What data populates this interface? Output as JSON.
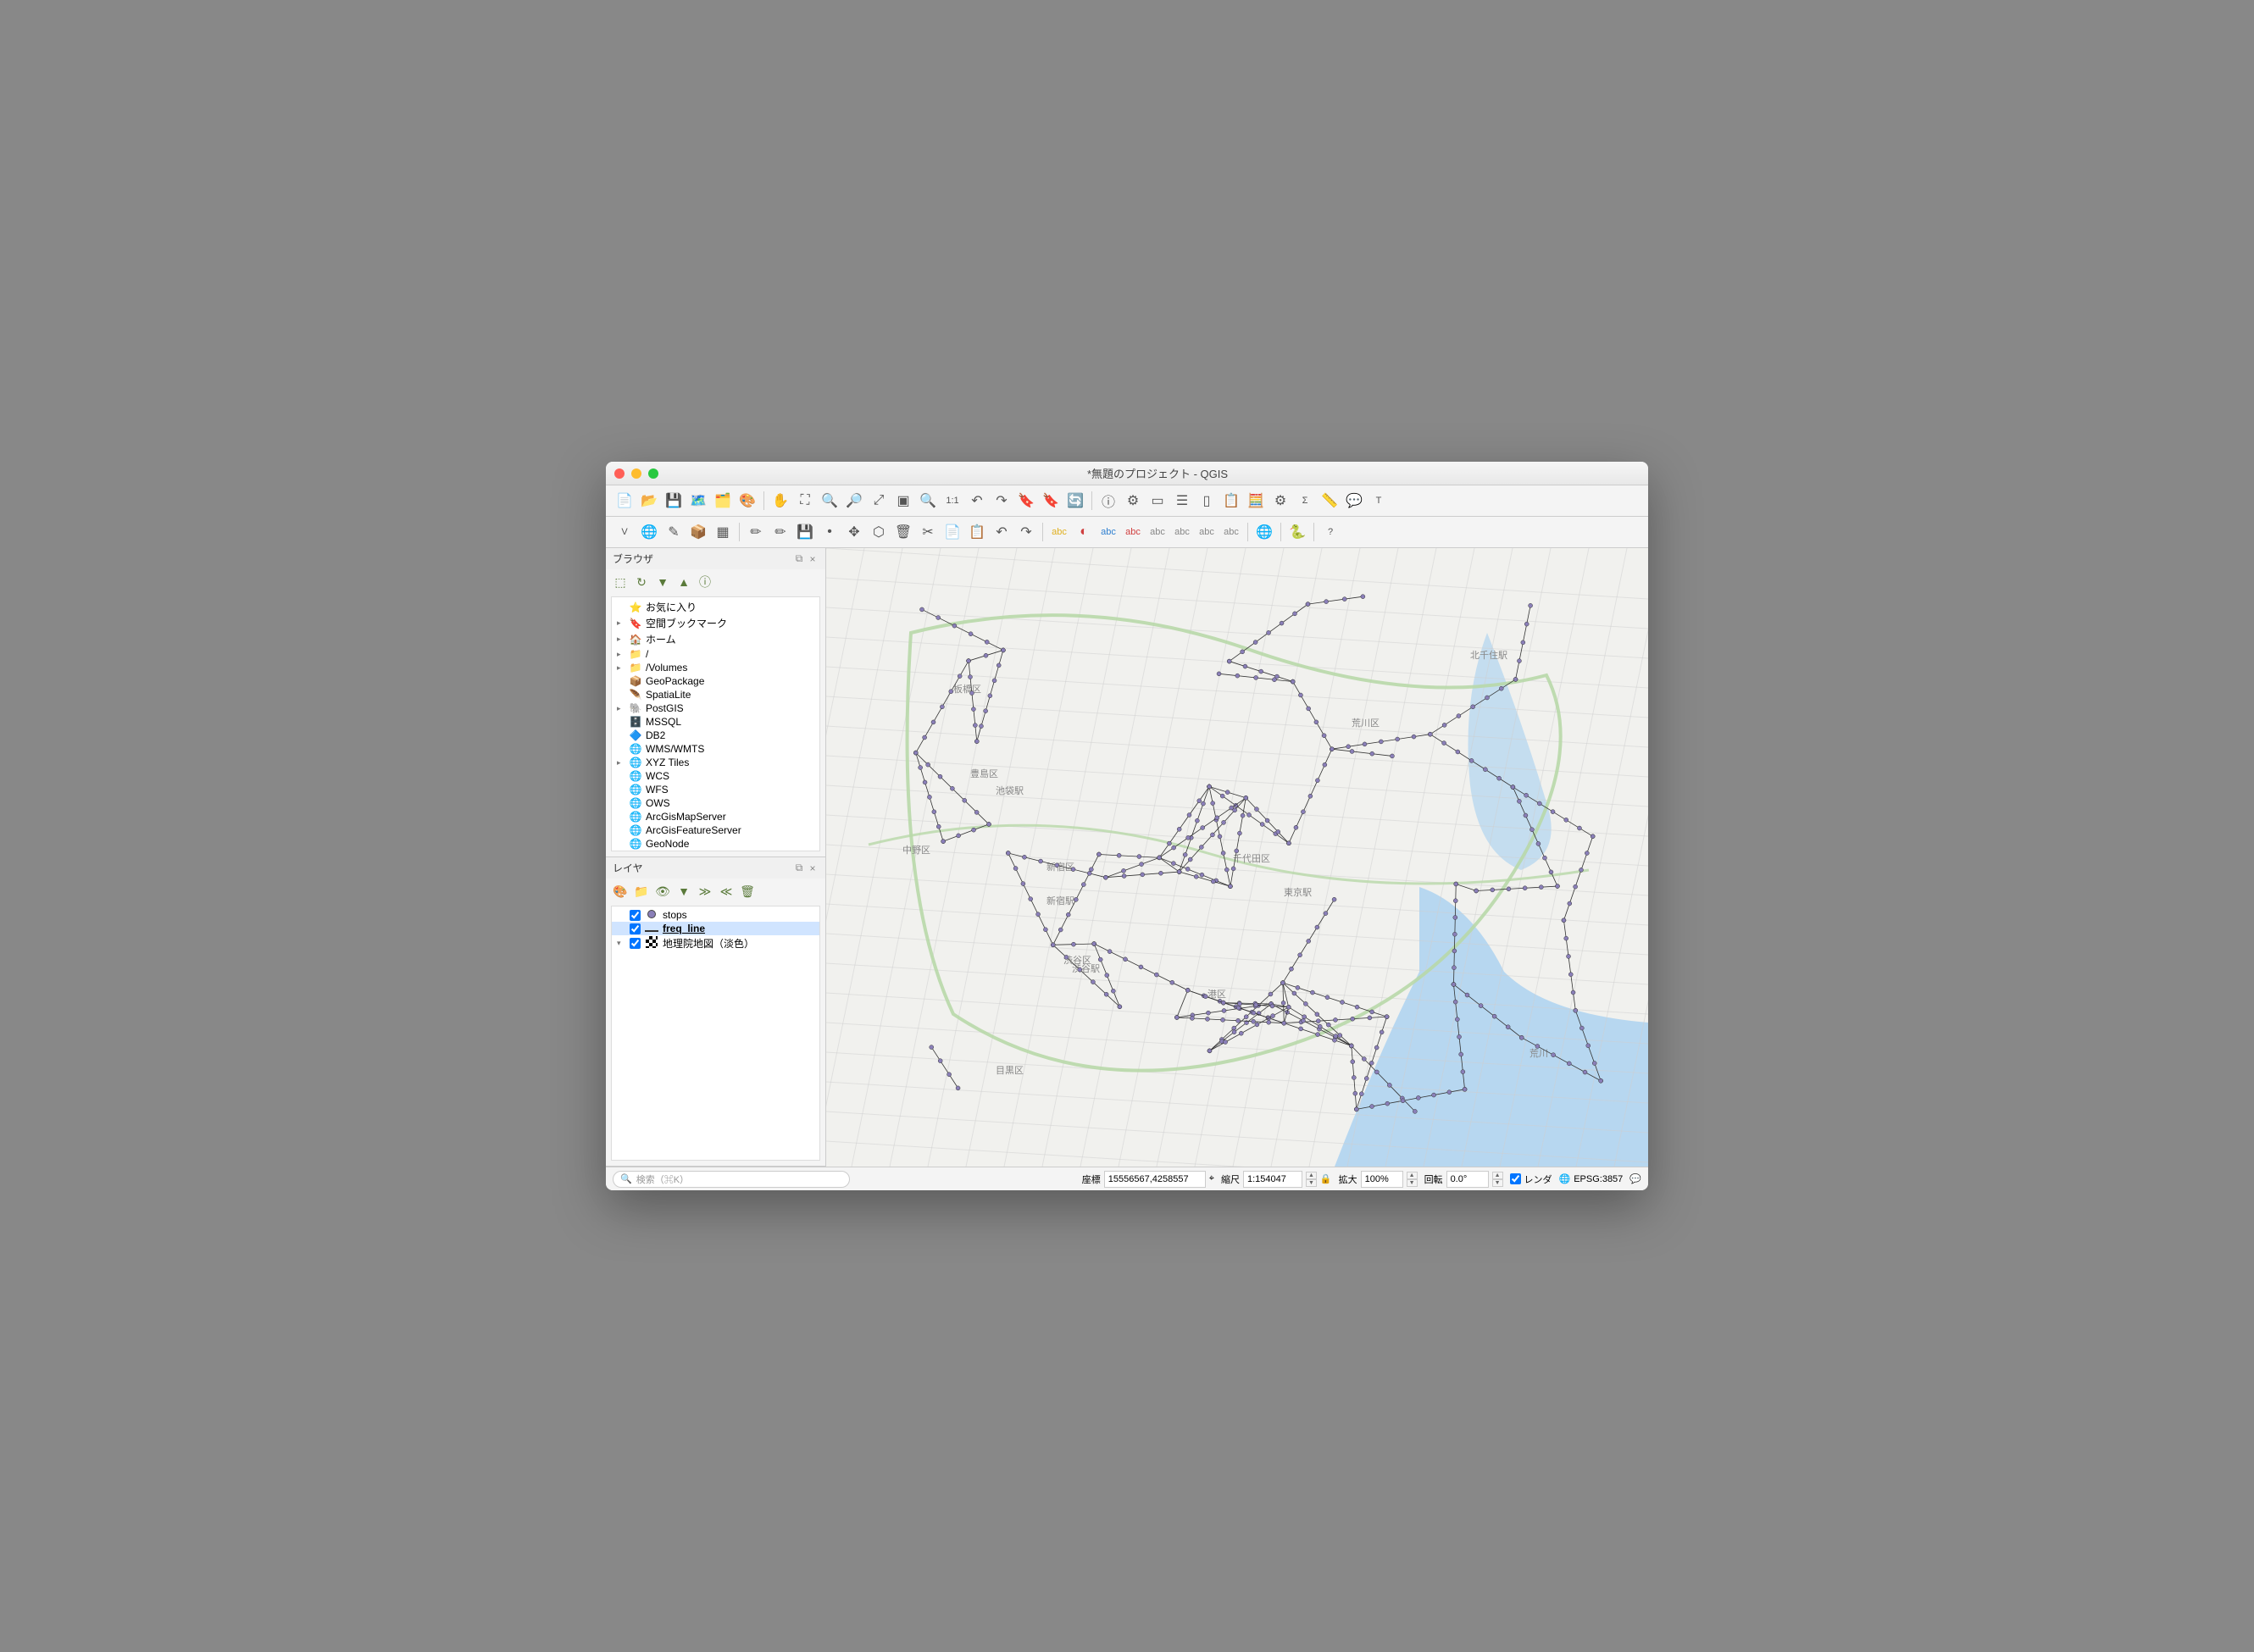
{
  "window": {
    "title": "*無題のプロジェクト - QGIS"
  },
  "toolbars": {
    "row1": [
      {
        "name": "new-project-icon",
        "glyph": "📄"
      },
      {
        "name": "open-project-icon",
        "glyph": "📂"
      },
      {
        "name": "save-project-icon",
        "glyph": "💾"
      },
      {
        "name": "new-print-layout-icon",
        "glyph": "🗺️"
      },
      {
        "name": "layout-manager-icon",
        "glyph": "🗂️"
      },
      {
        "name": "style-manager-icon",
        "glyph": "🎨"
      },
      {
        "sep": true
      },
      {
        "name": "pan-icon",
        "glyph": "✋"
      },
      {
        "name": "pan-to-selection-icon",
        "glyph": "⛶"
      },
      {
        "name": "zoom-in-icon",
        "glyph": "🔍"
      },
      {
        "name": "zoom-out-icon",
        "glyph": "🔎"
      },
      {
        "name": "zoom-full-icon",
        "glyph": "⤢"
      },
      {
        "name": "zoom-selection-icon",
        "glyph": "▣"
      },
      {
        "name": "zoom-layer-icon",
        "glyph": "🔍"
      },
      {
        "name": "zoom-native-icon",
        "glyph": "1:1"
      },
      {
        "name": "zoom-last-icon",
        "glyph": "↶"
      },
      {
        "name": "zoom-next-icon",
        "glyph": "↷"
      },
      {
        "name": "new-bookmark-icon",
        "glyph": "🔖"
      },
      {
        "name": "show-bookmarks-icon",
        "glyph": "🔖"
      },
      {
        "name": "refresh-icon",
        "glyph": "🔄"
      },
      {
        "sep": true
      },
      {
        "name": "identify-icon",
        "glyph": "ⓘ"
      },
      {
        "name": "action-icon",
        "glyph": "⚙"
      },
      {
        "name": "select-features-icon",
        "glyph": "▭"
      },
      {
        "name": "select-by-value-icon",
        "glyph": "☰"
      },
      {
        "name": "deselect-icon",
        "glyph": "▯"
      },
      {
        "name": "attribute-table-icon",
        "glyph": "📋"
      },
      {
        "name": "field-calc-icon",
        "glyph": "🧮"
      },
      {
        "name": "toolbox-icon",
        "glyph": "⚙"
      },
      {
        "name": "statistics-icon",
        "glyph": "Σ"
      },
      {
        "name": "measure-icon",
        "glyph": "📏"
      },
      {
        "name": "map-tips-icon",
        "glyph": "💬"
      },
      {
        "name": "text-annotation-icon",
        "glyph": "T"
      }
    ],
    "row2": [
      {
        "name": "add-vector-icon",
        "glyph": "V"
      },
      {
        "name": "add-raster-icon",
        "glyph": "🌐"
      },
      {
        "name": "new-shapefile-icon",
        "glyph": "✎"
      },
      {
        "name": "new-geopackage-icon",
        "glyph": "📦"
      },
      {
        "name": "new-memory-icon",
        "glyph": "▦"
      },
      {
        "sep": true
      },
      {
        "name": "current-edits-icon",
        "glyph": "✏"
      },
      {
        "name": "toggle-editing-icon",
        "glyph": "✏"
      },
      {
        "name": "save-edits-icon",
        "glyph": "💾"
      },
      {
        "name": "add-feature-icon",
        "glyph": "•"
      },
      {
        "name": "move-feature-icon",
        "glyph": "✥"
      },
      {
        "name": "node-tool-icon",
        "glyph": "⬡"
      },
      {
        "name": "delete-selected-icon",
        "glyph": "🗑"
      },
      {
        "name": "cut-icon",
        "glyph": "✂"
      },
      {
        "name": "copy-icon",
        "glyph": "📄"
      },
      {
        "name": "paste-icon",
        "glyph": "📋"
      },
      {
        "name": "undo-icon",
        "glyph": "↶"
      },
      {
        "name": "redo-icon",
        "glyph": "↷"
      },
      {
        "sep": true
      },
      {
        "name": "label-single-icon",
        "glyph": "abc",
        "color": "#e0b020"
      },
      {
        "name": "diagram-icon",
        "glyph": "◐",
        "color": "#d04040"
      },
      {
        "name": "label-highlight-icon",
        "glyph": "abc",
        "color": "#3080d0"
      },
      {
        "name": "label-pin-icon",
        "glyph": "abc",
        "color": "#d04040"
      },
      {
        "name": "label-show-hide-icon",
        "glyph": "abc",
        "color": "#888"
      },
      {
        "name": "label-move-icon",
        "glyph": "abc",
        "color": "#888"
      },
      {
        "name": "label-rotate-icon",
        "glyph": "abc",
        "color": "#888"
      },
      {
        "name": "label-change-icon",
        "glyph": "abc",
        "color": "#888"
      },
      {
        "sep": true
      },
      {
        "name": "metasearch-icon",
        "glyph": "🌐"
      },
      {
        "sep": true
      },
      {
        "name": "python-console-icon",
        "glyph": "🐍"
      },
      {
        "sep": true
      },
      {
        "name": "help-icon",
        "glyph": "?"
      }
    ]
  },
  "panels": {
    "browser": {
      "title": "ブラウザ",
      "toolbar": [
        "add-layer-icon",
        "refresh-icon",
        "filter-icon",
        "collapse-icon",
        "properties-icon"
      ],
      "items": [
        {
          "label": "お気に入り",
          "icon": "star",
          "toggle": ""
        },
        {
          "label": "空間ブックマーク",
          "icon": "bookmark",
          "toggle": "▸"
        },
        {
          "label": "ホーム",
          "icon": "home",
          "toggle": "▸"
        },
        {
          "label": "/",
          "icon": "folder",
          "toggle": "▸"
        },
        {
          "label": "/Volumes",
          "icon": "folder",
          "toggle": "▸"
        },
        {
          "label": "GeoPackage",
          "icon": "geopackage",
          "toggle": ""
        },
        {
          "label": "SpatiaLite",
          "icon": "spatialite",
          "toggle": ""
        },
        {
          "label": "PostGIS",
          "icon": "postgis",
          "toggle": "▸"
        },
        {
          "label": "MSSQL",
          "icon": "mssql",
          "toggle": ""
        },
        {
          "label": "DB2",
          "icon": "db2",
          "toggle": ""
        },
        {
          "label": "WMS/WMTS",
          "icon": "globe",
          "toggle": ""
        },
        {
          "label": "XYZ Tiles",
          "icon": "globe",
          "toggle": "▸"
        },
        {
          "label": "WCS",
          "icon": "globe",
          "toggle": ""
        },
        {
          "label": "WFS",
          "icon": "globe",
          "toggle": ""
        },
        {
          "label": "OWS",
          "icon": "globe",
          "toggle": ""
        },
        {
          "label": "ArcGisMapServer",
          "icon": "globe",
          "toggle": ""
        },
        {
          "label": "ArcGisFeatureServer",
          "icon": "globe",
          "toggle": ""
        },
        {
          "label": "GeoNode",
          "icon": "globe",
          "toggle": ""
        }
      ]
    },
    "layers": {
      "title": "レイヤ",
      "toolbar": [
        "open-style-icon",
        "add-group-icon",
        "visibility-icon",
        "filter-legend-icon",
        "expand-icon",
        "collapse-icon",
        "remove-icon"
      ],
      "items": [
        {
          "label": "stops",
          "checked": true,
          "symbol": "point",
          "selected": false,
          "bold": false,
          "toggle": ""
        },
        {
          "label": "freq_line",
          "checked": true,
          "symbol": "line",
          "selected": true,
          "bold": true,
          "toggle": ""
        },
        {
          "label": "地理院地図（淡色）",
          "checked": true,
          "symbol": "tile",
          "selected": false,
          "bold": false,
          "toggle": "▾"
        }
      ]
    }
  },
  "statusbar": {
    "search_placeholder": "検索（⌘K）",
    "coord_label": "座標",
    "coord_value": "15556567,4258557",
    "scale_label": "縮尺",
    "scale_value": "1:154047",
    "magnifier_label": "拡大",
    "magnifier_value": "100%",
    "rotation_label": "回転",
    "rotation_value": "0.0°",
    "render_label": "レンダ",
    "render_checked": true,
    "crs_label": "EPSG:3857"
  },
  "map": {
    "basemap_labels": [
      "板橋区",
      "豊島区",
      "中野区",
      "新宿区",
      "千代田区",
      "港区",
      "目黒区",
      "渋谷区",
      "荒川区",
      "北千住駅",
      "池袋駅",
      "新宿駅",
      "渋谷駅",
      "東京駅",
      "荒川"
    ],
    "transit_points_sample_count": 900,
    "transit_line_color": "#333333",
    "stop_point_color": "#8a7fb8",
    "water_color": "#b0d4f0",
    "road_color": "#cfcfcf",
    "park_color": "#b8d8a8"
  }
}
